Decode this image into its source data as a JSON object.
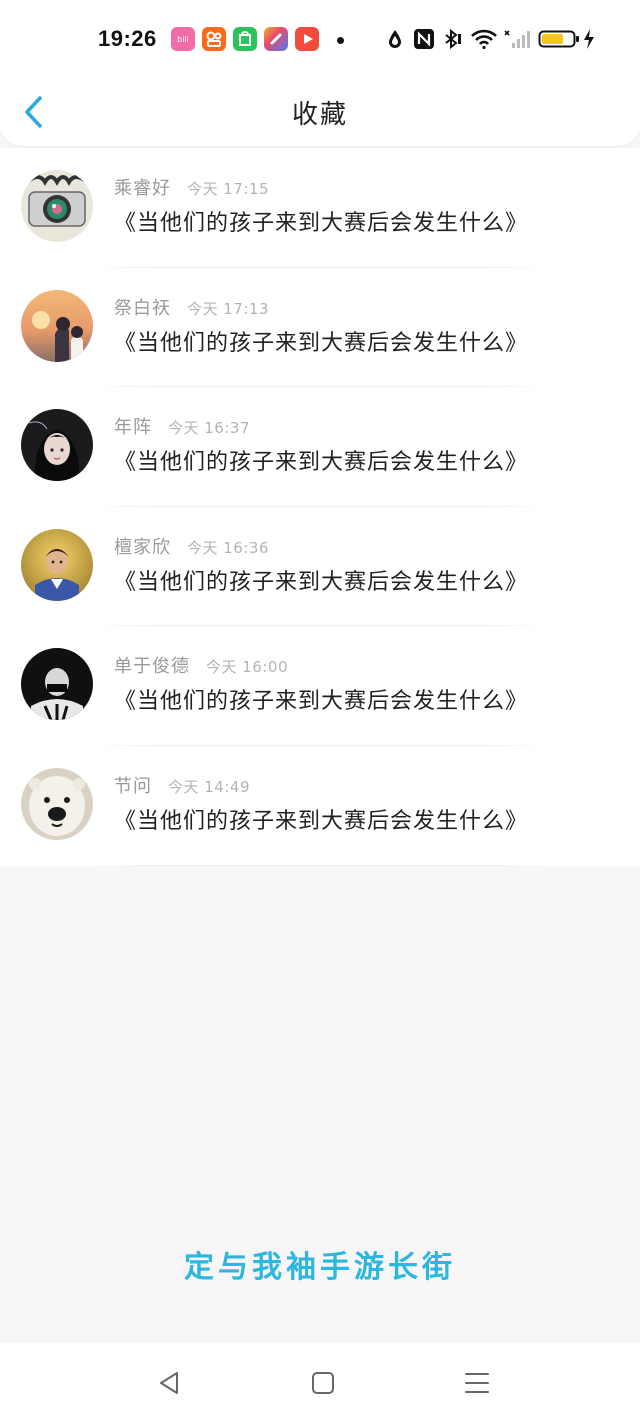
{
  "status_bar": {
    "time": "19:26",
    "app_icons": [
      {
        "name": "bilibili-app-icon",
        "color": "#f06ba8"
      },
      {
        "name": "kuaishou-app-icon",
        "color": "#ff6a1a"
      },
      {
        "name": "shopping-app-icon",
        "color": "#2ec25a"
      },
      {
        "name": "multicolor-app-icon",
        "color": "#4a7bf0"
      },
      {
        "name": "video-app-icon",
        "color": "#f04b3c"
      }
    ],
    "battery_color": "#f5c518"
  },
  "header": {
    "title": "收藏",
    "accent_color": "#2aa8e0"
  },
  "favorites": [
    {
      "name": "乘睿好",
      "time": "今天 17:15",
      "title": "《当他们的孩子来到大赛后会发生什么》"
    },
    {
      "name": "祭白祆",
      "time": "今天 17:13",
      "title": "《当他们的孩子来到大赛后会发生什么》"
    },
    {
      "name": "年阵",
      "time": "今天 16:37",
      "title": "《当他们的孩子来到大赛后会发生什么》"
    },
    {
      "name": "檀家欣",
      "time": "今天 16:36",
      "title": "《当他们的孩子来到大赛后会发生什么》"
    },
    {
      "name": "单于俊德",
      "time": "今天 16:00",
      "title": "《当他们的孩子来到大赛后会发生什么》"
    },
    {
      "name": "节问",
      "time": "今天 14:49",
      "title": "《当他们的孩子来到大赛后会发生什么》"
    }
  ],
  "footer": {
    "slogan": "定与我袖手游长街",
    "slogan_color": "#2cb7e0"
  }
}
